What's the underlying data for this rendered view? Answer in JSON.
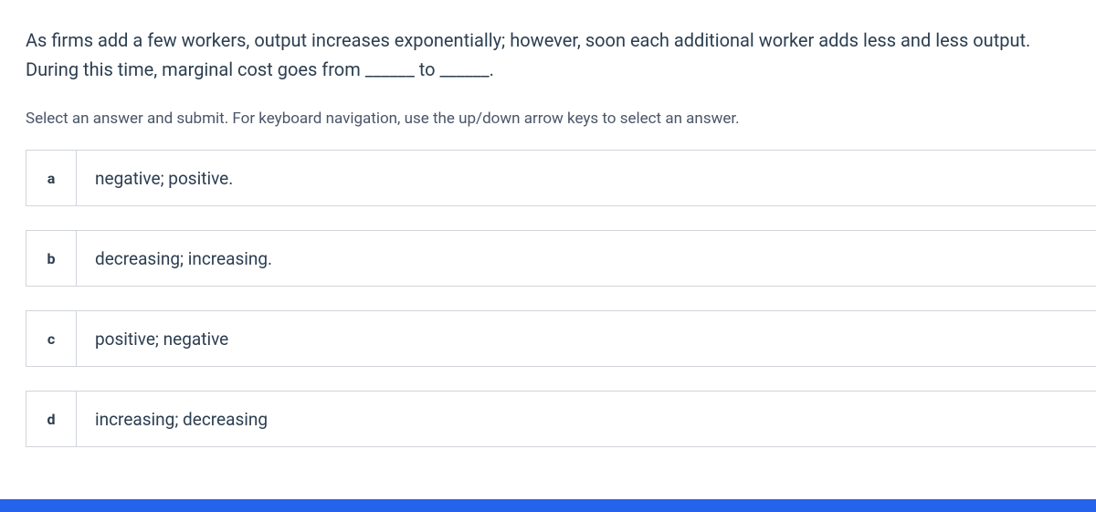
{
  "question": "As firms add a few workers, output increases exponentially; however, soon each additional worker adds less and less output. During this time, marginal cost goes from ______ to ______.",
  "instruction": "Select an answer and submit. For keyboard navigation, use the up/down arrow keys to select an answer.",
  "options": [
    {
      "letter": "a",
      "text": "negative; positive."
    },
    {
      "letter": "b",
      "text": "decreasing; increasing."
    },
    {
      "letter": "c",
      "text": "positive; negative"
    },
    {
      "letter": "d",
      "text": "increasing; decreasing"
    }
  ]
}
